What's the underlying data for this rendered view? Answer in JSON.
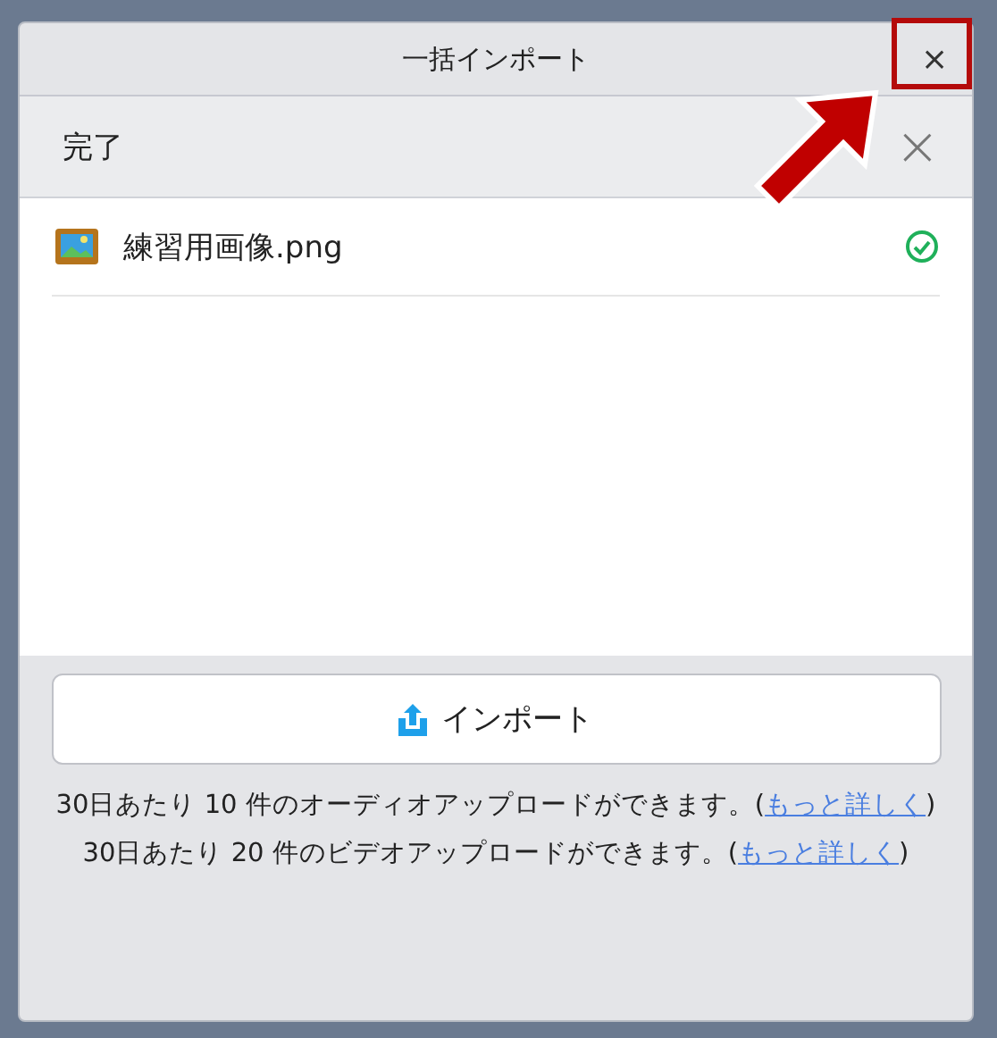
{
  "window": {
    "title": "一括インポート",
    "close": "×"
  },
  "header": {
    "title": "完了",
    "close": "×"
  },
  "files": [
    {
      "name": "練習用画像.png",
      "done": true
    }
  ],
  "import_button": {
    "label": "インポート"
  },
  "notes": [
    {
      "text": "30日あたり 10 件のオーディオアップロードができます。(",
      "link": "もっと詳しく",
      "after": ")"
    },
    {
      "text": "30日あたり 20 件のビデオアップロードができます。(",
      "link": "もっと詳しく",
      "after": ")"
    }
  ]
}
